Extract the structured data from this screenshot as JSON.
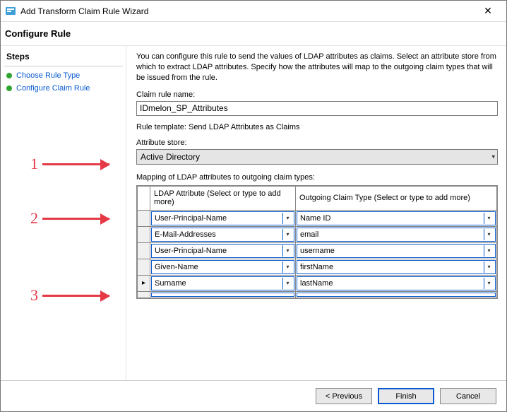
{
  "window": {
    "title": "Add Transform Claim Rule Wizard",
    "subtitle": "Configure Rule"
  },
  "steps": {
    "heading": "Steps",
    "items": [
      {
        "label": "Choose Rule Type"
      },
      {
        "label": "Configure Claim Rule"
      }
    ]
  },
  "content": {
    "description": "You can configure this rule to send the values of LDAP attributes as claims. Select an attribute store from which to extract LDAP attributes. Specify how the attributes will map to the outgoing claim types that will be issued from the rule.",
    "claim_rule_name_label": "Claim rule name:",
    "claim_rule_name_value": "IDmelon_SP_Attributes",
    "rule_template_text": "Rule template: Send LDAP Attributes as Claims",
    "attribute_store_label": "Attribute store:",
    "attribute_store_value": "Active Directory",
    "mapping_label": "Mapping of LDAP attributes to outgoing claim types:",
    "columns": {
      "ldap": "LDAP Attribute (Select or type to add more)",
      "claim": "Outgoing Claim Type (Select or type to add more)"
    },
    "rows": [
      {
        "ldap": "User-Principal-Name",
        "claim": "Name ID"
      },
      {
        "ldap": "E-Mail-Addresses",
        "claim": "email"
      },
      {
        "ldap": "User-Principal-Name",
        "claim": "username"
      },
      {
        "ldap": "Given-Name",
        "claim": "firstName"
      },
      {
        "ldap": "Surname",
        "claim": "lastName"
      }
    ]
  },
  "footer": {
    "previous": "< Previous",
    "finish": "Finish",
    "cancel": "Cancel"
  },
  "annotations": {
    "n1": "1",
    "n2": "2",
    "n3": "3"
  }
}
